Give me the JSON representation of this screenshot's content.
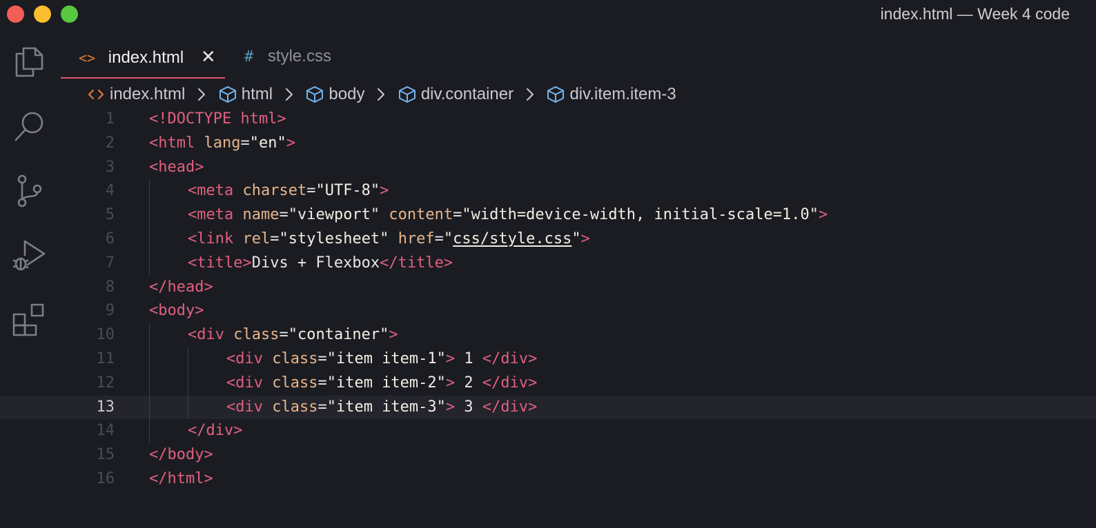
{
  "window": {
    "title": "index.html — Week 4 code",
    "traffic_colors": {
      "close": "#f25f58",
      "minimize": "#fbbe2e",
      "maximize": "#58c840"
    }
  },
  "activity_bar": {
    "icons": [
      "files-icon",
      "search-icon",
      "source-control-icon",
      "run-debug-icon",
      "extensions-icon"
    ]
  },
  "tabs": [
    {
      "label": "index.html",
      "icon": "<>",
      "icon_color": "#e37933",
      "active": true,
      "close": "✕"
    },
    {
      "label": "style.css",
      "icon": "#",
      "icon_color": "#519aba",
      "active": false
    }
  ],
  "breadcrumb": [
    {
      "label": "index.html",
      "icon": "html-file-icon"
    },
    {
      "label": "html",
      "icon": "element-cube-icon"
    },
    {
      "label": "body",
      "icon": "element-cube-icon"
    },
    {
      "label": "div.container",
      "icon": "element-cube-icon"
    },
    {
      "label": "div.item.item-3",
      "icon": "element-cube-icon"
    }
  ],
  "editor": {
    "current_line": 13,
    "lines": [
      {
        "n": "1",
        "indent": 0,
        "tokens": [
          [
            "t",
            "<!DOCTYPE html>"
          ]
        ]
      },
      {
        "n": "2",
        "indent": 0,
        "tokens": [
          [
            "t",
            "<html"
          ],
          [
            "x",
            " "
          ],
          [
            "a",
            "lang"
          ],
          [
            "x",
            "="
          ],
          [
            "s",
            "\"en\""
          ],
          [
            "t",
            ">"
          ]
        ]
      },
      {
        "n": "3",
        "indent": 0,
        "tokens": [
          [
            "t",
            "<head>"
          ]
        ]
      },
      {
        "n": "4",
        "indent": 1,
        "tokens": [
          [
            "t",
            "<meta"
          ],
          [
            "x",
            " "
          ],
          [
            "a",
            "charset"
          ],
          [
            "x",
            "="
          ],
          [
            "s",
            "\"UTF-8\""
          ],
          [
            "t",
            ">"
          ]
        ]
      },
      {
        "n": "5",
        "indent": 1,
        "tokens": [
          [
            "t",
            "<meta"
          ],
          [
            "x",
            " "
          ],
          [
            "a",
            "name"
          ],
          [
            "x",
            "="
          ],
          [
            "s",
            "\"viewport\""
          ],
          [
            "x",
            " "
          ],
          [
            "a",
            "content"
          ],
          [
            "x",
            "="
          ],
          [
            "s",
            "\"width=device-width, initial-scale=1.0\""
          ],
          [
            "t",
            ">"
          ]
        ]
      },
      {
        "n": "6",
        "indent": 1,
        "tokens": [
          [
            "t",
            "<link"
          ],
          [
            "x",
            " "
          ],
          [
            "a",
            "rel"
          ],
          [
            "x",
            "="
          ],
          [
            "s",
            "\"stylesheet\""
          ],
          [
            "x",
            " "
          ],
          [
            "a",
            "href"
          ],
          [
            "x",
            "="
          ],
          [
            "s",
            "\""
          ],
          [
            "su",
            "css/style.css"
          ],
          [
            "s",
            "\""
          ],
          [
            "t",
            ">"
          ]
        ]
      },
      {
        "n": "7",
        "indent": 1,
        "tokens": [
          [
            "t",
            "<title>"
          ],
          [
            "x",
            "Divs + Flexbox"
          ],
          [
            "t",
            "</title>"
          ]
        ]
      },
      {
        "n": "8",
        "indent": 0,
        "tokens": [
          [
            "t",
            "</head>"
          ]
        ]
      },
      {
        "n": "9",
        "indent": 0,
        "tokens": [
          [
            "t",
            "<body>"
          ]
        ]
      },
      {
        "n": "10",
        "indent": 1,
        "tokens": [
          [
            "t",
            "<div"
          ],
          [
            "x",
            " "
          ],
          [
            "a",
            "class"
          ],
          [
            "x",
            "="
          ],
          [
            "s",
            "\"container\""
          ],
          [
            "t",
            ">"
          ]
        ]
      },
      {
        "n": "11",
        "indent": 2,
        "tokens": [
          [
            "t",
            "<div"
          ],
          [
            "x",
            " "
          ],
          [
            "a",
            "class"
          ],
          [
            "x",
            "="
          ],
          [
            "s",
            "\"item item-1\""
          ],
          [
            "t",
            ">"
          ],
          [
            "x",
            " 1 "
          ],
          [
            "t",
            "</div>"
          ]
        ]
      },
      {
        "n": "12",
        "indent": 2,
        "tokens": [
          [
            "t",
            "<div"
          ],
          [
            "x",
            " "
          ],
          [
            "a",
            "class"
          ],
          [
            "x",
            "="
          ],
          [
            "s",
            "\"item item-2\""
          ],
          [
            "t",
            ">"
          ],
          [
            "x",
            " 2 "
          ],
          [
            "t",
            "</div>"
          ]
        ]
      },
      {
        "n": "13",
        "indent": 2,
        "tokens": [
          [
            "t",
            "<div"
          ],
          [
            "x",
            " "
          ],
          [
            "a",
            "class"
          ],
          [
            "x",
            "="
          ],
          [
            "s",
            "\"item item-3\""
          ],
          [
            "t",
            ">"
          ],
          [
            "x",
            " 3 "
          ],
          [
            "t",
            "</div>"
          ]
        ]
      },
      {
        "n": "14",
        "indent": 1,
        "tokens": [
          [
            "t",
            "</div>"
          ]
        ]
      },
      {
        "n": "15",
        "indent": 0,
        "tokens": [
          [
            "t",
            "</body>"
          ]
        ]
      },
      {
        "n": "16",
        "indent": 0,
        "tokens": [
          [
            "t",
            "</html>"
          ]
        ]
      }
    ]
  }
}
